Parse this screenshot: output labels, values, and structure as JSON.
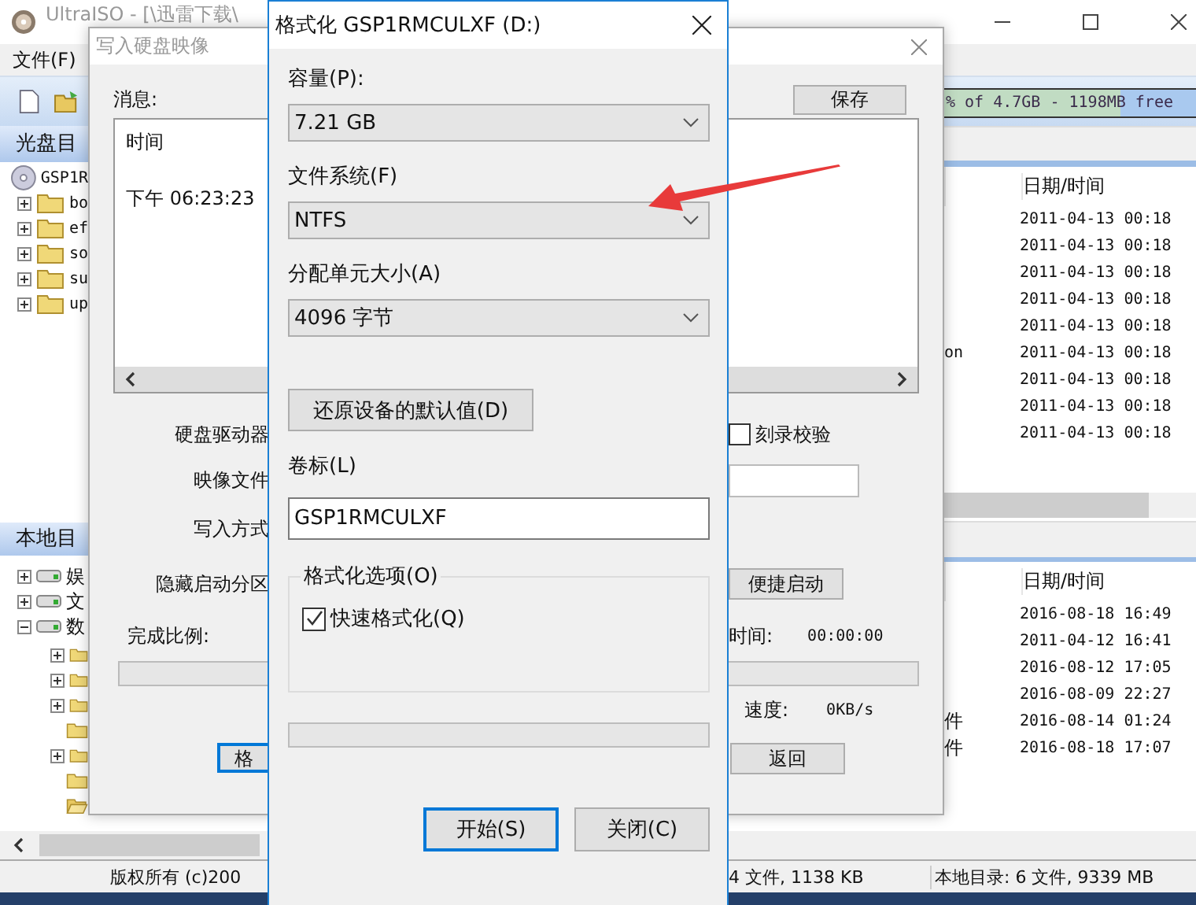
{
  "main_window": {
    "title": "UltraISO - [\\迅雷下载\\",
    "menu": [
      "文件(F)"
    ],
    "disc_usage": {
      "text": "% of 4.7GB - 1198MB free",
      "level": 0.7
    },
    "image_pane": {
      "header": "光盘目",
      "tree": [
        {
          "label": "GSP1R",
          "kind": "disc",
          "children": [
            {
              "label": "bo",
              "kind": "folder",
              "expanded": false
            },
            {
              "label": "ef",
              "kind": "folder",
              "expanded": false
            },
            {
              "label": "so",
              "kind": "folder",
              "expanded": false
            },
            {
              "label": "su",
              "kind": "folder",
              "expanded": false
            },
            {
              "label": "up",
              "kind": "folder",
              "expanded": false
            }
          ]
        }
      ]
    },
    "image_files": {
      "column": "日期/时间",
      "rows": [
        {
          "date": "2011-04-13 00:18"
        },
        {
          "date": "2011-04-13 00:18"
        },
        {
          "date": "2011-04-13 00:18"
        },
        {
          "date": "2011-04-13 00:18"
        },
        {
          "date": "2011-04-13 00:18"
        },
        {
          "name": "on",
          "date": "2011-04-13 00:18"
        },
        {
          "date": "2011-04-13 00:18"
        },
        {
          "date": "2011-04-13 00:18"
        },
        {
          "date": "2011-04-13 00:18"
        }
      ]
    },
    "local_pane": {
      "header": "本地目",
      "tree": [
        {
          "label": "娱",
          "kind": "drive",
          "expanded": false
        },
        {
          "label": "文",
          "kind": "drive",
          "expanded": false
        },
        {
          "label": "数",
          "kind": "drive",
          "expanded": true,
          "children": [
            {
              "kind": "folder",
              "expanded": false
            },
            {
              "kind": "folder",
              "expanded": false
            },
            {
              "kind": "folder",
              "expanded": false
            },
            {
              "kind": "folder"
            },
            {
              "kind": "folder",
              "expanded": false
            },
            {
              "kind": "folder"
            },
            {
              "kind": "open_folder"
            }
          ]
        }
      ]
    },
    "local_files": {
      "column": "日期/时间",
      "rows": [
        {
          "date": "2016-08-18 16:49"
        },
        {
          "date": "2011-04-12 16:41"
        },
        {
          "date": "2016-08-12 17:05"
        },
        {
          "date": "2016-08-09 22:27"
        },
        {
          "name": "件",
          "date": "2016-08-14 01:24"
        },
        {
          "name": "件",
          "date": "2016-08-18 17:07"
        }
      ]
    },
    "status_bar": [
      "版权所有 (c)200",
      "4 文件, 1138 KB",
      "本地目录: 6 文件, 9339 MB"
    ]
  },
  "write_dialog": {
    "title": "写入硬盘映像",
    "message_label": "消息:",
    "save_button": "保存",
    "messages": [
      "时间",
      "下午 06:23:23"
    ],
    "labels": [
      "硬盘驱动器",
      "映像文件",
      "写入方式",
      "隐藏启动分区"
    ],
    "verify": {
      "label": "刻录校验",
      "checked": false
    },
    "quick_boot_button": "便捷启动",
    "progress_label": "完成比例:",
    "time_label": "时间:",
    "time": "00:00:00",
    "progress": {
      "level": 0
    },
    "speed_label": "速度:",
    "speed": "0KB/s",
    "format_button": "格",
    "back_button": "返回"
  },
  "format_dialog": {
    "title": "格式化 GSP1RMCULXF (D:)",
    "selects": [
      {
        "label": "容量(P):",
        "value": "7.21 GB"
      },
      {
        "label": "文件系统(F)",
        "value": "NTFS"
      },
      {
        "label": "分配单元大小(A)",
        "value": "4096 字节"
      }
    ],
    "restore_button": "还原设备的默认值(D)",
    "volume": {
      "label": "卷标(L)",
      "value": "GSP1RMCULXF"
    },
    "options": {
      "title": "格式化选项(O)",
      "quick_format": {
        "label": "快速格式化(Q)",
        "checked": true
      }
    },
    "progress": {
      "level": 0
    },
    "buttons": [
      {
        "label": "开始(S)",
        "default": true
      },
      {
        "label": "关闭(C)",
        "default": false
      }
    ]
  }
}
